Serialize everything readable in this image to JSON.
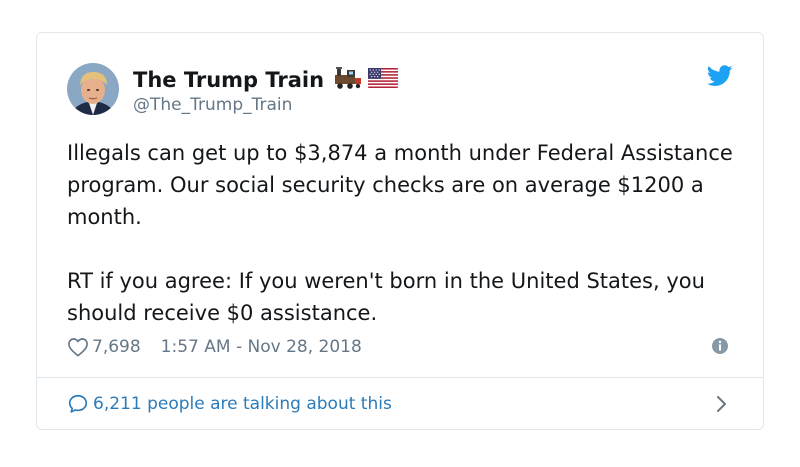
{
  "tweet": {
    "display_name": "The Trump Train",
    "name_emoji": [
      "train-emoji",
      "us-flag-emoji"
    ],
    "handle": "@The_Trump_Train",
    "text_paragraphs": [
      "Illegals can get up to $3,874 a month under Federal Assistance program. Our social security checks are on average $1200 a month.",
      "RT if you agree: If you weren't born in the United States, you should receive $0 assistance."
    ],
    "likes": "7,698",
    "timestamp": "1:57 AM - Nov 28, 2018",
    "talking": "6,211 people are talking about this"
  },
  "icons": {
    "brand": "twitter-bird-icon",
    "like": "heart-icon",
    "info": "info-icon",
    "reply": "speech-bubble-icon",
    "more": "chevron-right-icon"
  },
  "colors": {
    "text": "#14171a",
    "muted": "#657786",
    "link": "#2b7bb9",
    "twitter_blue": "#1da1f2",
    "border": "#e1e8ed"
  }
}
